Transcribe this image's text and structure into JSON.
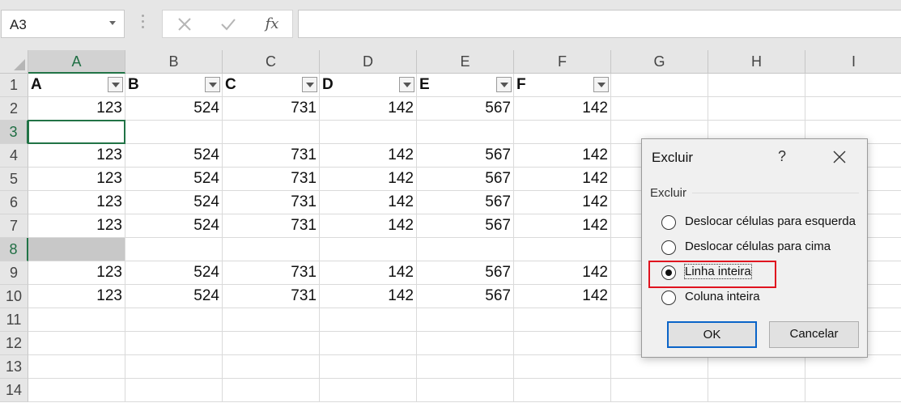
{
  "formula_bar": {
    "name_box": "A3",
    "cancel_icon": "cancel-icon",
    "enter_icon": "checkmark-icon",
    "fx_label": "fx",
    "formula": ""
  },
  "sheet": {
    "columns": [
      "A",
      "B",
      "C",
      "D",
      "E",
      "F",
      "G",
      "H",
      "I"
    ],
    "selected_column": "A",
    "rows": [
      "1",
      "2",
      "3",
      "4",
      "5",
      "6",
      "7",
      "8",
      "9",
      "10",
      "11",
      "12",
      "13",
      "14"
    ],
    "selected_rows": [
      "3",
      "8"
    ],
    "active_cell": "A3",
    "header_row": [
      "A",
      "B",
      "C",
      "D",
      "E",
      "F"
    ],
    "data": [
      [
        "123",
        "524",
        "731",
        "142",
        "567",
        "142"
      ],
      [],
      [
        "123",
        "524",
        "731",
        "142",
        "567",
        "142"
      ],
      [
        "123",
        "524",
        "731",
        "142",
        "567",
        "142"
      ],
      [
        "123",
        "524",
        "731",
        "142",
        "567",
        "142"
      ],
      [
        "123",
        "524",
        "731",
        "142",
        "567",
        "142"
      ],
      [],
      [
        "123",
        "524",
        "731",
        "142",
        "567",
        "142"
      ],
      [
        "123",
        "524",
        "731",
        "142",
        "567",
        "142"
      ]
    ]
  },
  "dialog": {
    "title": "Excluir",
    "help": "?",
    "group_label": "Excluir",
    "options": [
      {
        "label": "Deslocar células para esquerda",
        "checked": false
      },
      {
        "label": "Deslocar células para cima",
        "checked": false
      },
      {
        "label": "Linha inteira",
        "checked": true
      },
      {
        "label": "Coluna inteira",
        "checked": false
      }
    ],
    "ok_label": "OK",
    "cancel_label": "Cancelar",
    "highlight_color": "#e0131f"
  },
  "colors": {
    "excel_green": "#217346",
    "selection_gray": "#c8c8c8",
    "focus_blue": "#0a64c8"
  }
}
